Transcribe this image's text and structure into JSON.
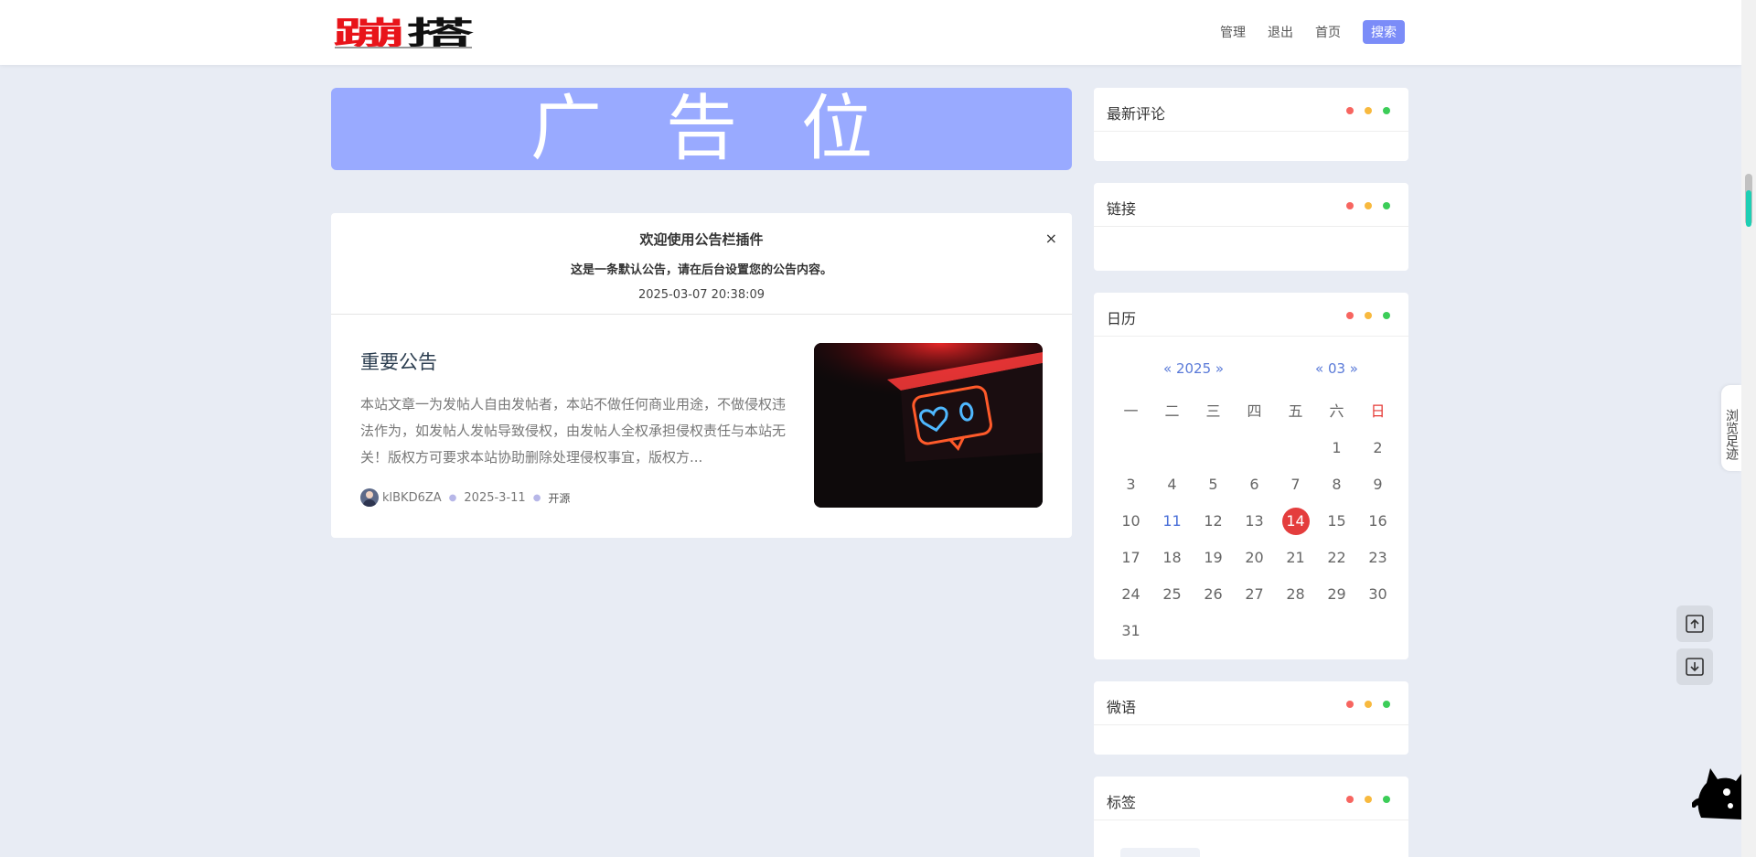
{
  "header": {
    "logo_text": "蹦搭",
    "nav": [
      "管理",
      "退出",
      "首页"
    ],
    "search_label": "搜索"
  },
  "ad": {
    "text": "广告位"
  },
  "notice": {
    "title": "欢迎使用公告栏插件",
    "text": "这是一条默认公告，请在后台设置您的公告内容。",
    "time": "2025-03-07 20:38:09",
    "close": "×"
  },
  "post": {
    "title": "重要公告",
    "excerpt": "本站文章一为发帖人自由发帖者，本站不做任何商业用途，不做侵权违法作为，如发帖人发帖导致侵权，由发帖人全权承担侵权责任与本站无关！版权方可要求本站协助删除处理侵权事宜，版权方...",
    "author": "klBKD6ZA",
    "date": "2025-3-11",
    "tag": "开源",
    "thumb_icon": "neon-heart-like-sign"
  },
  "sidebar": {
    "latest_comments": "最新评论",
    "links": "链接",
    "calendar": "日历",
    "weiyu": "微语",
    "tags": "标签"
  },
  "calendar": {
    "year_nav": "« 2025 »",
    "month_nav": "« 03 »",
    "weekdays": [
      "一",
      "二",
      "三",
      "四",
      "五",
      "六",
      "日"
    ],
    "weeks": [
      [
        "",
        "",
        "",
        "",
        "",
        "1",
        "2"
      ],
      [
        "3",
        "4",
        "5",
        "6",
        "7",
        "8",
        "9"
      ],
      [
        "10",
        "11",
        "12",
        "13",
        "14",
        "15",
        "16"
      ],
      [
        "17",
        "18",
        "19",
        "20",
        "21",
        "22",
        "23"
      ],
      [
        "24",
        "25",
        "26",
        "27",
        "28",
        "29",
        "30"
      ],
      [
        "31",
        "",
        "",
        "",
        "",
        "",
        ""
      ]
    ],
    "today": "14",
    "linked_day": "11"
  },
  "side_tools": {
    "footprint": "浏览足迹",
    "back_to_top_icon": "arrow-up-icon",
    "to_bottom_icon": "arrow-down-icon"
  },
  "colors": {
    "accent": "#7b8cf8",
    "ad_bg": "#99aaff",
    "today": "#e43d3d",
    "dot_red": "#f76560",
    "dot_yellow": "#f8b93e",
    "dot_green": "#3ccd58"
  }
}
